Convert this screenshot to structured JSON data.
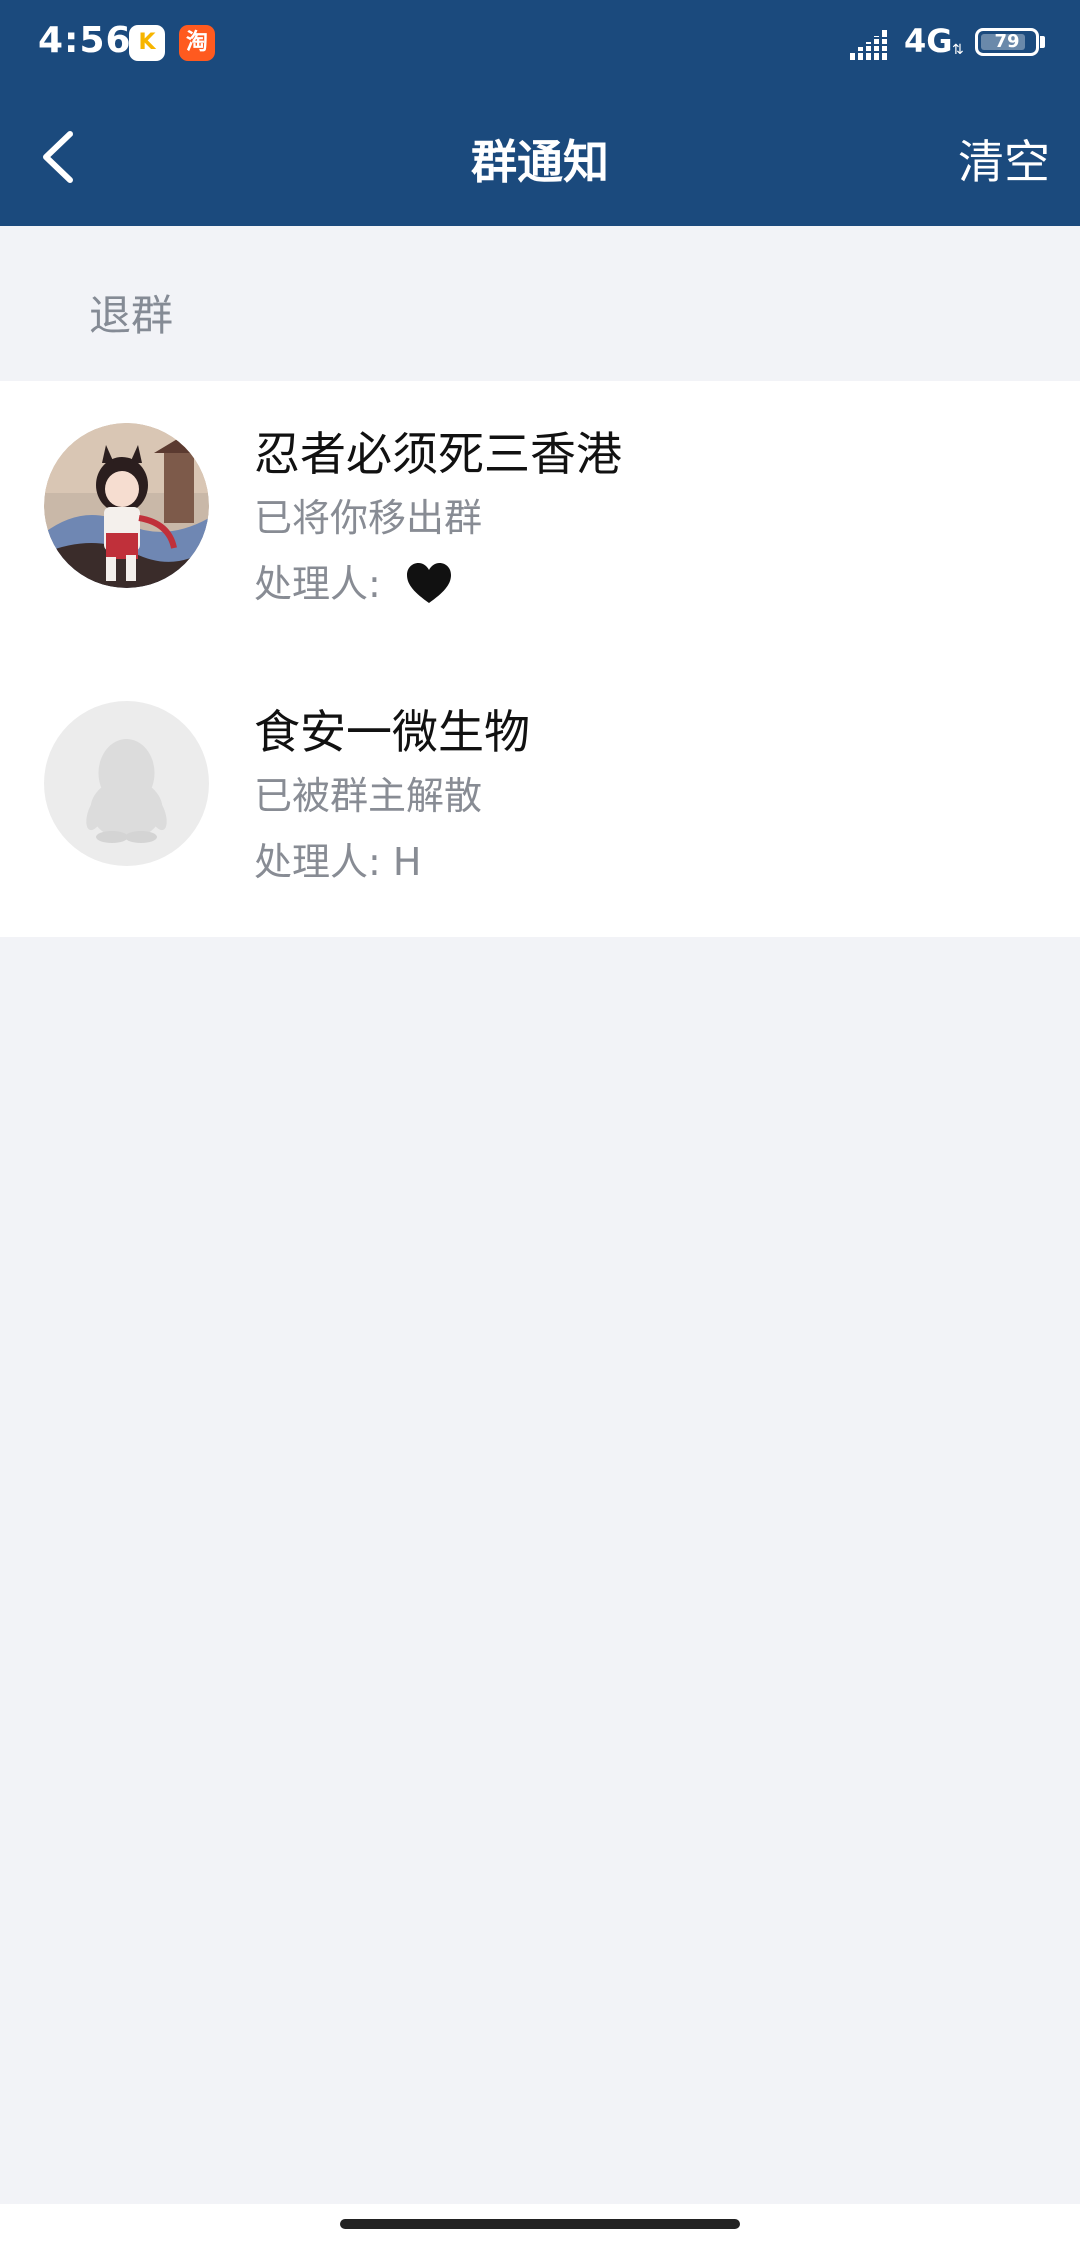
{
  "status_bar": {
    "time": "4:56",
    "apps": [
      {
        "name": "kuaishou",
        "glyph": "K"
      },
      {
        "name": "taobao",
        "glyph": "淘"
      }
    ],
    "network": "4G",
    "battery": "79"
  },
  "nav": {
    "title": "群通知",
    "clear_label": "清空"
  },
  "section": {
    "title": "退群"
  },
  "notifications": [
    {
      "name": "忍者必须死三香港",
      "description": "已将你移出群",
      "handler_label": "处理人:",
      "handler_value": "",
      "handler_icon": "black-heart-icon",
      "avatar": "anime-girl-avatar"
    },
    {
      "name": "食安一微生物",
      "description": "已被群主解散",
      "handler_label": "处理人:",
      "handler_value": "H",
      "avatar": "default-penguin-avatar"
    }
  ],
  "colors": {
    "nav_blue": "#1b4a7d",
    "page_bg": "#f2f3f7",
    "secondary_text": "#888c94"
  }
}
